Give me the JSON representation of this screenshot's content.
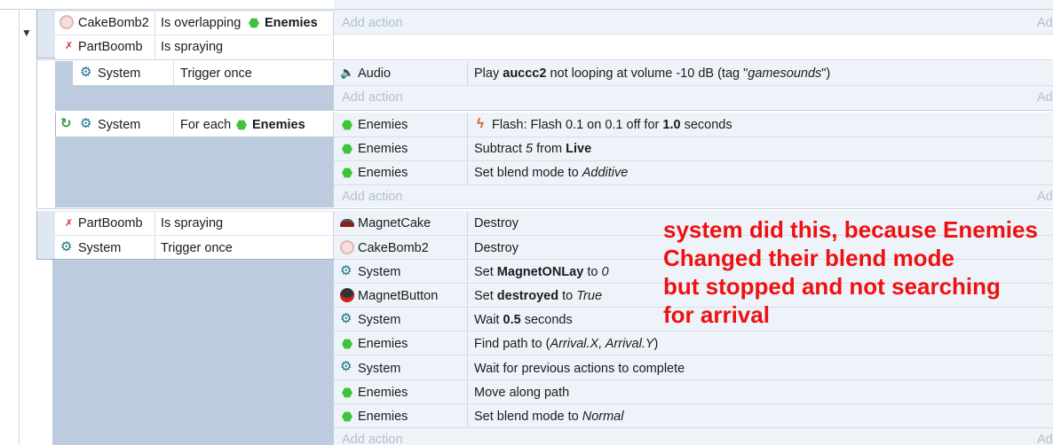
{
  "common": {
    "add_action": "Add action",
    "add_action_short": "Ad"
  },
  "event1": {
    "conditions": [
      {
        "object": "CakeBomb2",
        "text": "Is overlapping",
        "param": "Enemies"
      },
      {
        "object": "PartBoomb",
        "text": "Is spraying"
      }
    ]
  },
  "sub1": {
    "condition": {
      "object": "System",
      "text": "Trigger once"
    },
    "actions": [
      {
        "object": "Audio",
        "pre": "Play ",
        "bold": "auccc2",
        "mid": " not looping at volume -10 dB (tag \"",
        "italic": "gamesounds",
        "post": "\")"
      }
    ]
  },
  "sub2": {
    "condition": {
      "object": "System",
      "text": "For each",
      "param": "Enemies"
    },
    "actions": [
      {
        "object": "Enemies",
        "pre": "Flash: Flash 0.1 on 0.1 off for ",
        "bold": "1.0",
        "post": " seconds"
      },
      {
        "object": "Enemies",
        "pre": "Subtract ",
        "italic": "5",
        "mid": " from ",
        "bold": "Live"
      },
      {
        "object": "Enemies",
        "pre": "Set blend mode to ",
        "italic": "Additive"
      }
    ]
  },
  "event2": {
    "conditions": [
      {
        "object": "PartBoomb",
        "text": "Is spraying"
      },
      {
        "object": "System",
        "text": "Trigger once"
      }
    ],
    "actions": [
      {
        "object": "MagnetCake",
        "text": "Destroy"
      },
      {
        "object": "CakeBomb2",
        "text": "Destroy"
      },
      {
        "object": "System",
        "pre": "Set ",
        "bold": "MagnetONLay",
        "mid": " to ",
        "italic": "0"
      },
      {
        "object": "MagnetButton",
        "pre": "Set ",
        "bold": "destroyed",
        "mid": " to ",
        "italic": "True"
      },
      {
        "object": "System",
        "pre": "Wait ",
        "bold": "0.5",
        "post": " seconds"
      },
      {
        "object": "Enemies",
        "pre": "Find path to (",
        "italic": "Arrival.X, Arrival.Y",
        "post": ")"
      },
      {
        "object": "System",
        "text": "Wait for previous actions to complete"
      },
      {
        "object": "Enemies",
        "text": "Move along path"
      },
      {
        "object": "Enemies",
        "pre": "Set blend mode to ",
        "italic": "Normal"
      }
    ]
  },
  "annotation": {
    "lines": [
      "system did this, because Enemies",
      "Changed their blend mode",
      "but stopped and not searching",
      "for arrival"
    ]
  },
  "colors": {
    "annotation": "#ee1111",
    "enemies_icon": "#3ec43a",
    "system_icon": "#1b6f86",
    "add_action": "#b3bfcd"
  }
}
